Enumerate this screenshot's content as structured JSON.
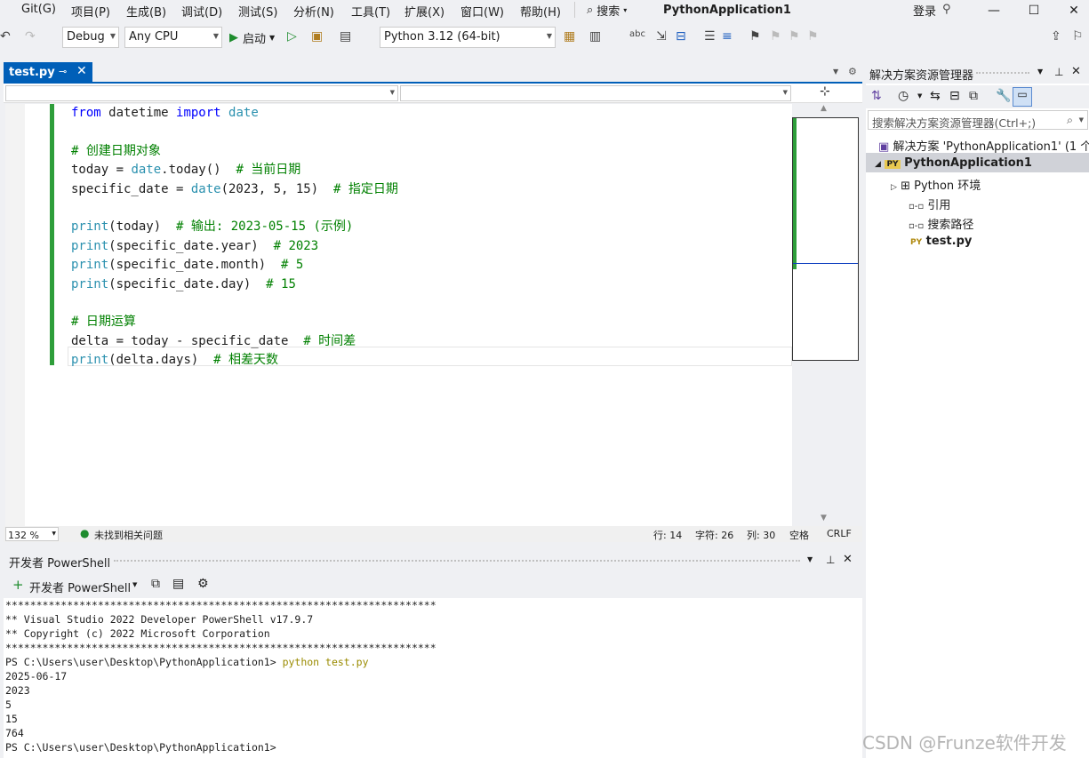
{
  "menu": {
    "items": [
      "Git(G)",
      "项目(P)",
      "生成(B)",
      "调试(D)",
      "测试(S)",
      "分析(N)",
      "工具(T)",
      "扩展(X)",
      "窗口(W)",
      "帮助(H)"
    ],
    "search_label": "搜索",
    "app_title": "PythonApplication1",
    "login": "登录"
  },
  "toolbar": {
    "config": "Debug",
    "platform": "Any CPU",
    "start_label": "启动",
    "python_env": "Python 3.12 (64-bit)"
  },
  "editor": {
    "tab_label": "test.py",
    "code_lines": [
      [
        {
          "t": "from",
          "c": "kw"
        },
        {
          "t": " datetime "
        },
        {
          "t": "import",
          "c": "kw"
        },
        {
          "t": " "
        },
        {
          "t": "date",
          "c": "ty"
        }
      ],
      [],
      [
        {
          "t": "# 创建日期对象",
          "c": "cm"
        }
      ],
      [
        {
          "t": "today = "
        },
        {
          "t": "date",
          "c": "ty"
        },
        {
          "t": ".today()  "
        },
        {
          "t": "# 当前日期",
          "c": "cm"
        }
      ],
      [
        {
          "t": "specific_date = "
        },
        {
          "t": "date",
          "c": "ty"
        },
        {
          "t": "(2023, 5, 15)  "
        },
        {
          "t": "# 指定日期",
          "c": "cm"
        }
      ],
      [],
      [
        {
          "t": "print",
          "c": "ty"
        },
        {
          "t": "(today)  "
        },
        {
          "t": "# 输出: 2023-05-15 (示例)",
          "c": "cm"
        }
      ],
      [
        {
          "t": "print",
          "c": "ty"
        },
        {
          "t": "(specific_date.year)  "
        },
        {
          "t": "# 2023",
          "c": "cm"
        }
      ],
      [
        {
          "t": "print",
          "c": "ty"
        },
        {
          "t": "(specific_date.month)  "
        },
        {
          "t": "# 5",
          "c": "cm"
        }
      ],
      [
        {
          "t": "print",
          "c": "ty"
        },
        {
          "t": "(specific_date.day)  "
        },
        {
          "t": "# 15",
          "c": "cm"
        }
      ],
      [],
      [
        {
          "t": "# 日期运算",
          "c": "cm"
        }
      ],
      [
        {
          "t": "delta = today - specific_date  "
        },
        {
          "t": "# 时间差",
          "c": "cm"
        }
      ],
      [
        {
          "t": "print",
          "c": "ty"
        },
        {
          "t": "(delta.days)  "
        },
        {
          "t": "# 相差天数",
          "c": "cm"
        }
      ]
    ]
  },
  "status": {
    "zoom": "132 %",
    "issues": "未找到相关问题",
    "line": "行: 14",
    "char": "字符: 26",
    "col": "列: 30",
    "whitespace": "空格",
    "eol": "CRLF"
  },
  "terminal": {
    "panel_title": "开发者 PowerShell",
    "new_label": "开发者 PowerShell",
    "lines": [
      "**********************************************************************",
      "** Visual Studio 2022 Developer PowerShell v17.9.7",
      "** Copyright (c) 2022 Microsoft Corporation",
      "**********************************************************************",
      "PS C:\\Users\\user\\Desktop\\PythonApplication1> python test.py",
      "2025-06-17",
      "2023",
      "5",
      "15",
      "764",
      "PS C:\\Users\\user\\Desktop\\PythonApplication1>"
    ]
  },
  "solution": {
    "title": "解决方案资源管理器",
    "search_placeholder": "搜索解决方案资源管理器(Ctrl+;)",
    "root": "解决方案 'PythonApplication1' (1 个",
    "project": "PythonApplication1",
    "env": "Python 环境",
    "refs": "引用",
    "search_paths": "搜索路径",
    "file": "test.py"
  },
  "watermark": "CSDN @Frunze软件开发",
  "colors": {
    "accent": "#005fb8",
    "keyword": "#0000ff",
    "type": "#2b91af",
    "comment": "#008000",
    "change_bar": "#2e9e3a"
  }
}
